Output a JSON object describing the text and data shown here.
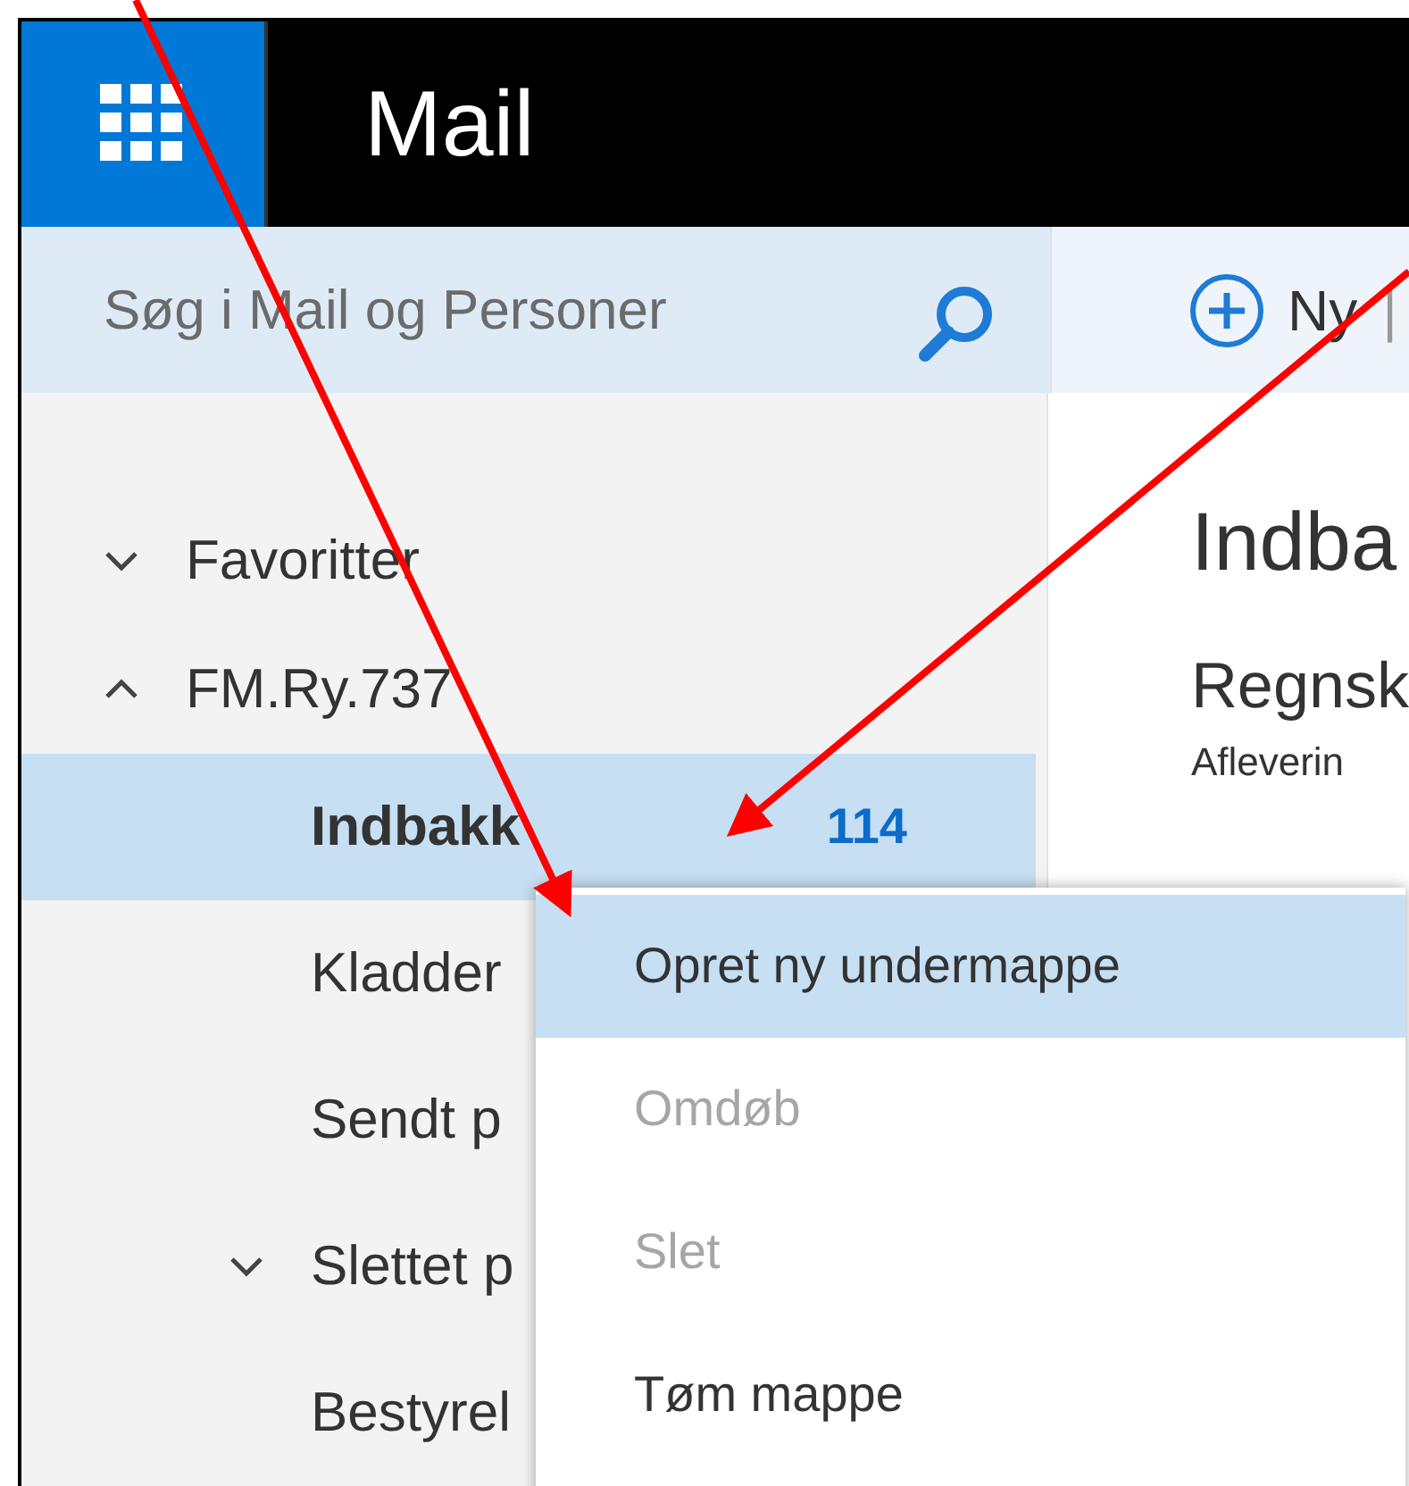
{
  "app_bar": {
    "title": "Mail"
  },
  "search": {
    "placeholder": "Søg i Mail og Personer"
  },
  "toolbar": {
    "new_label": "Ny",
    "separator": "|"
  },
  "sidebar": {
    "items": [
      {
        "label": "Favoritter",
        "expanded": false,
        "selected": false
      },
      {
        "label": "FM.Ry.737",
        "expanded": true,
        "selected": false,
        "children": [
          {
            "label": "Indbakk",
            "count": "114",
            "selected": true
          },
          {
            "label": "Kladder",
            "selected": false
          },
          {
            "label": "Sendt p",
            "selected": false
          },
          {
            "label": "Slettet p",
            "expanded": false,
            "selected": false
          },
          {
            "label": "Bestyrel",
            "selected": false
          }
        ]
      }
    ]
  },
  "content": {
    "heading": "Indba",
    "messages": [
      {
        "sender": "Regnsk",
        "preview": "Afleverin"
      }
    ]
  },
  "context_menu": {
    "items": [
      {
        "label": "Opret ny undermappe",
        "selected": true,
        "disabled": false
      },
      {
        "label": "Omdøb",
        "selected": false,
        "disabled": true
      },
      {
        "label": "Slet",
        "selected": false,
        "disabled": true
      },
      {
        "label": "Tøm mappe",
        "selected": false,
        "disabled": false
      }
    ]
  }
}
